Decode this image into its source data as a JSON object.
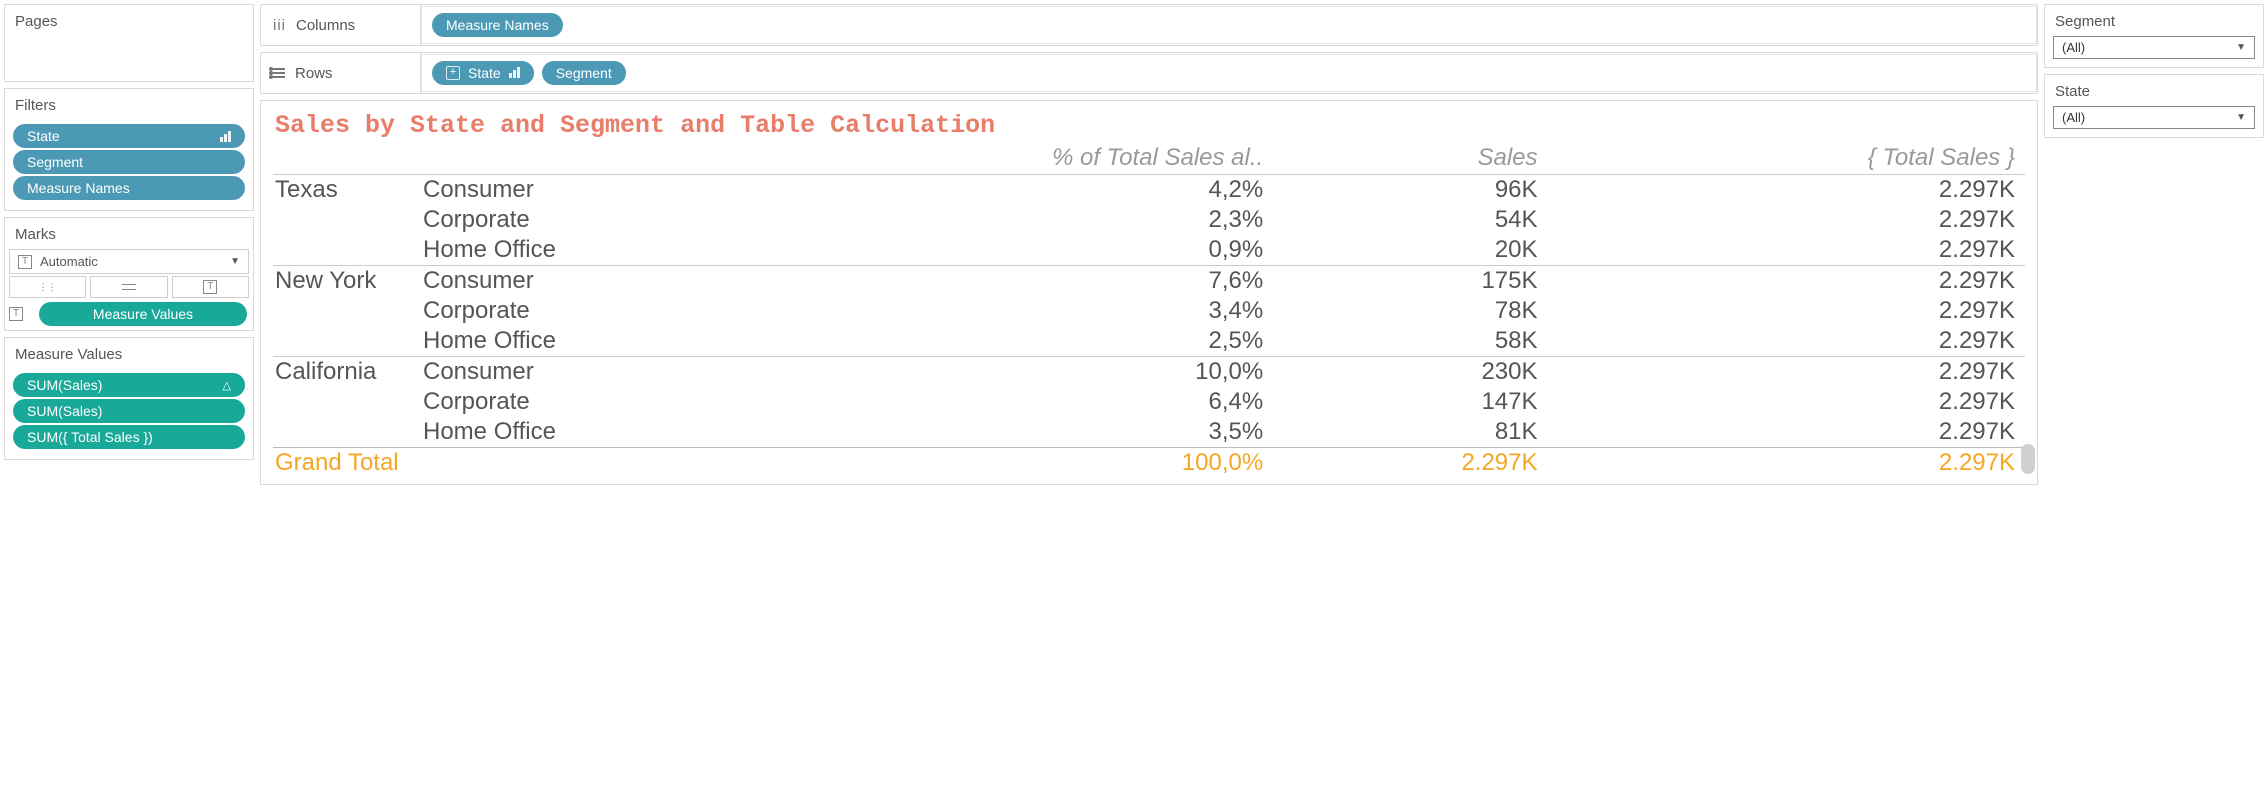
{
  "left": {
    "pages_label": "Pages",
    "filters_label": "Filters",
    "filter_pills": [
      "State",
      "Segment",
      "Measure Names"
    ],
    "marks_label": "Marks",
    "marks_type": "Automatic",
    "marks_text_pill": "Measure Values",
    "mv_label": "Measure Values",
    "mv_pills": [
      "SUM(Sales)",
      "SUM(Sales)",
      "SUM({ Total Sales })"
    ]
  },
  "shelves": {
    "columns_label": "Columns",
    "columns_pills": [
      "Measure Names"
    ],
    "rows_label": "Rows",
    "rows_pills": [
      "State",
      "Segment"
    ]
  },
  "viz": {
    "title": "Sales by State and Segment and Table Calculation",
    "headers": [
      "% of Total Sales al..",
      "Sales",
      "{ Total Sales }"
    ],
    "rows": [
      {
        "state": "Texas",
        "segment": "Consumer",
        "pct": "4,2%",
        "sales": "96K",
        "total": "2.297K"
      },
      {
        "state": "",
        "segment": "Corporate",
        "pct": "2,3%",
        "sales": "54K",
        "total": "2.297K"
      },
      {
        "state": "",
        "segment": "Home Office",
        "pct": "0,9%",
        "sales": "20K",
        "total": "2.297K"
      },
      {
        "state": "New York",
        "segment": "Consumer",
        "pct": "7,6%",
        "sales": "175K",
        "total": "2.297K"
      },
      {
        "state": "",
        "segment": "Corporate",
        "pct": "3,4%",
        "sales": "78K",
        "total": "2.297K"
      },
      {
        "state": "",
        "segment": "Home Office",
        "pct": "2,5%",
        "sales": "58K",
        "total": "2.297K"
      },
      {
        "state": "California",
        "segment": "Consumer",
        "pct": "10,0%",
        "sales": "230K",
        "total": "2.297K"
      },
      {
        "state": "",
        "segment": "Corporate",
        "pct": "6,4%",
        "sales": "147K",
        "total": "2.297K"
      },
      {
        "state": "",
        "segment": "Home Office",
        "pct": "3,5%",
        "sales": "81K",
        "total": "2.297K"
      }
    ],
    "grand": {
      "label": "Grand Total",
      "pct": "100,0%",
      "sales": "2.297K",
      "total": "2.297K"
    }
  },
  "right": {
    "segment_label": "Segment",
    "segment_value": "(All)",
    "state_label": "State",
    "state_value": "(All)"
  }
}
